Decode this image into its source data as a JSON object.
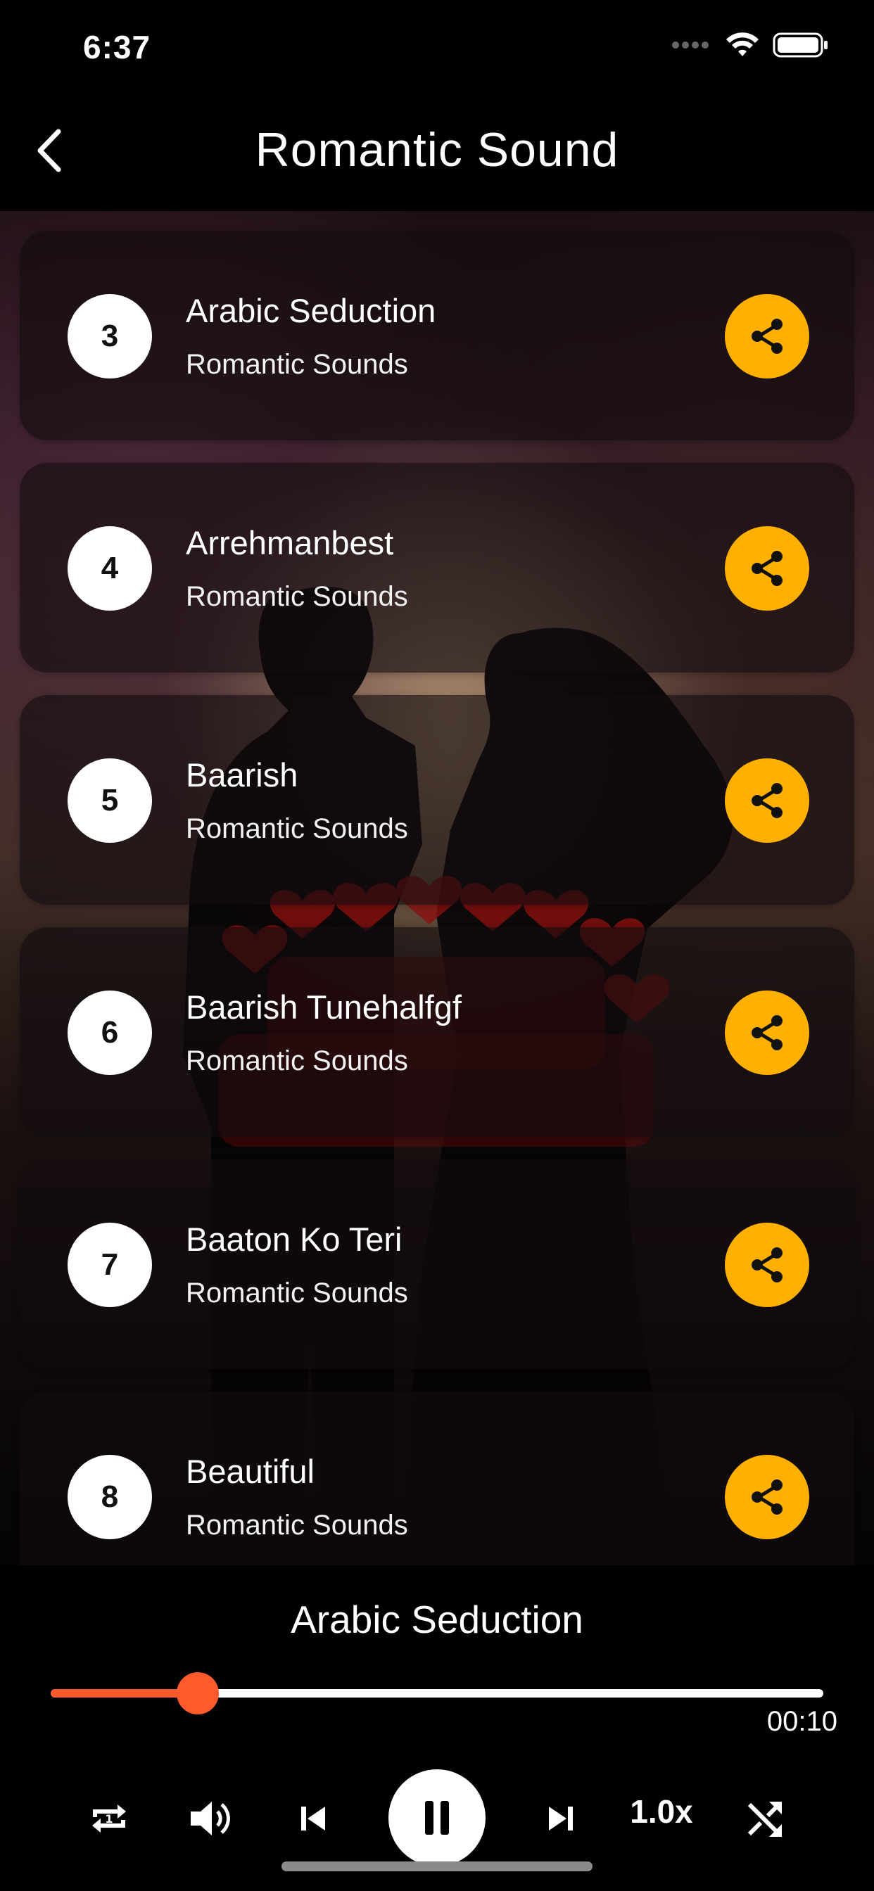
{
  "status": {
    "time": "6:37"
  },
  "header": {
    "title": "Romantic Sound"
  },
  "songs": [
    {
      "number": "3",
      "title": "Arabic Seduction",
      "subtitle": "Romantic Sounds"
    },
    {
      "number": "4",
      "title": "Arrehmanbest",
      "subtitle": "Romantic Sounds"
    },
    {
      "number": "5",
      "title": "Baarish",
      "subtitle": "Romantic Sounds"
    },
    {
      "number": "6",
      "title": "Baarish Tunehalfgf",
      "subtitle": "Romantic Sounds"
    },
    {
      "number": "7",
      "title": "Baaton Ko Teri",
      "subtitle": "Romantic Sounds"
    },
    {
      "number": "8",
      "title": "Beautiful",
      "subtitle": "Romantic Sounds"
    }
  ],
  "player": {
    "now_playing": "Arabic Seduction",
    "progress_fraction": 0.19,
    "time_remaining": "00:10",
    "speed": "1.0x"
  },
  "colors": {
    "accent_share": "#ffb000",
    "progress": "#ff5a2b"
  },
  "icons": {
    "back": "chevron-left-icon",
    "share": "share-icon",
    "repeat": "repeat-one-icon",
    "volume": "volume-icon",
    "previous": "skip-previous-icon",
    "pause": "pause-icon",
    "next": "skip-next-icon",
    "shuffle": "shuffle-icon"
  }
}
